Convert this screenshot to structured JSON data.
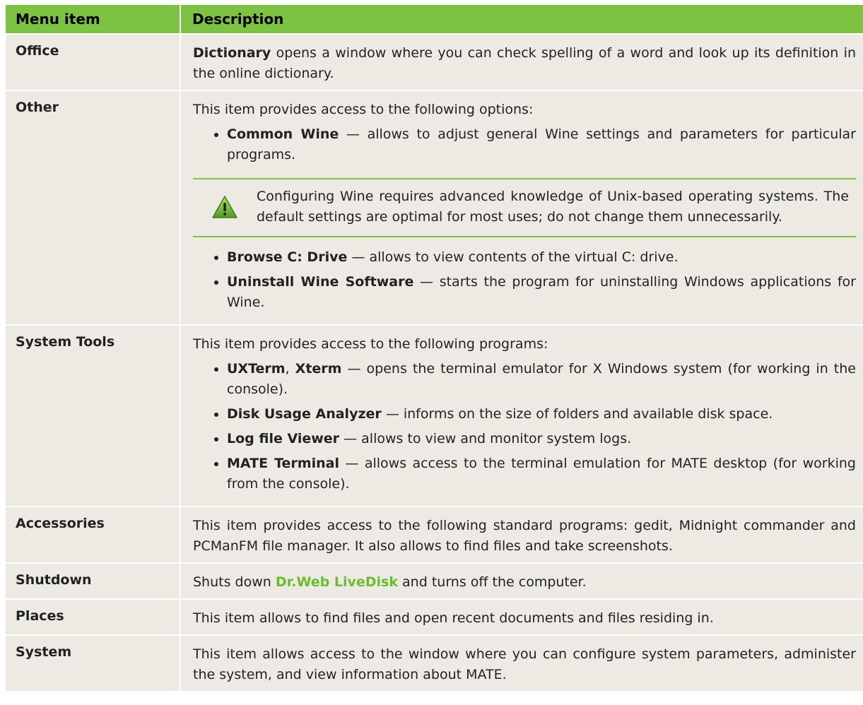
{
  "header": {
    "col1": "Menu item",
    "col2": "Description"
  },
  "rows": {
    "office": {
      "item": "Office",
      "bold": "Dictionary",
      "text": " opens a window where you can check spelling of a word and look up its definition in the online dictionary."
    },
    "other": {
      "item": "Other",
      "intro": "This item provides access to the following options:",
      "b1_bold": "Common Wine",
      "b1_text": " — allows to adjust general Wine settings and parameters for particular programs.",
      "note": "Configuring Wine requires advanced knowledge of Unix-based operating systems. The default settings are optimal for most uses; do not change them unnecessarily.",
      "b2_bold": "Browse C: Drive",
      "b2_text": " — allows to view contents of the virtual C: drive.",
      "b3_bold": "Uninstall Wine Software",
      "b3_text": " — starts the program for uninstalling Windows applications for Wine."
    },
    "system_tools": {
      "item": "System Tools",
      "intro": "This item provides access to the following programs:",
      "b1_bold_a": "UXTerm",
      "b1_sep": ", ",
      "b1_bold_b": "Xterm",
      "b1_text": " — opens the terminal emulator for X Windows system (for working in the console).",
      "b2_bold": "Disk Usage Analyzer",
      "b2_text": " — informs on the size of folders and available disk space.",
      "b3_bold": "Log file Viewer",
      "b3_text": " — allows to view and monitor system logs.",
      "b4_bold": "MATE Terminal",
      "b4_text": " — allows access to the terminal emulation for MATE desktop (for working from the console)."
    },
    "accessories": {
      "item": "Accessories",
      "text": "This item provides access to the following standard programs: gedit, Midnight commander and PCManFM file manager. It also allows to find files and take screenshots."
    },
    "shutdown": {
      "item": "Shutdown",
      "pre": "Shuts down ",
      "link": "Dr.Web LiveDisk",
      "post": " and turns off the computer."
    },
    "places": {
      "item": "Places",
      "text": "This item allows to find files and open recent documents and files residing in."
    },
    "system": {
      "item": "System",
      "text": "This item allows access to the window where you can configure system parameters, administer the system, and view information about MATE."
    }
  },
  "colors": {
    "accent": "#7dc242",
    "row_bg": "#ede9e3",
    "link": "#6bbd2f"
  },
  "icons": {
    "warning": "warning-triangle-icon"
  }
}
